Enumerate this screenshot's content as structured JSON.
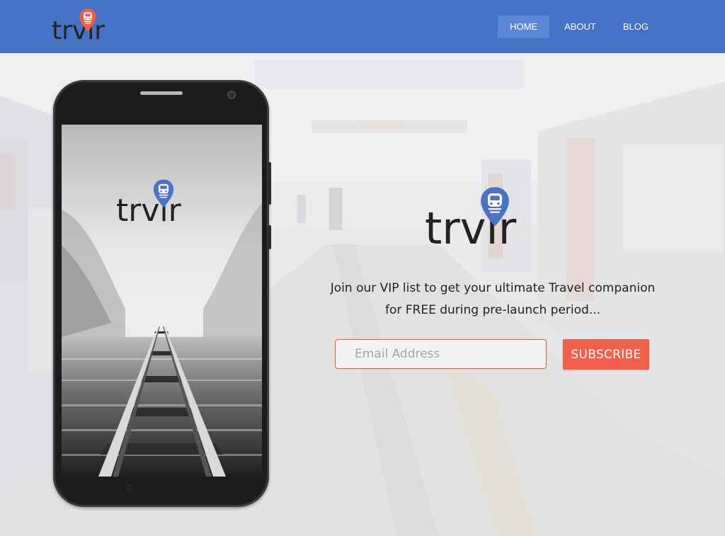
{
  "header": {
    "brand": "trvlr",
    "nav": [
      {
        "label": "HOME",
        "active": true
      },
      {
        "label": "ABOUT",
        "active": false
      },
      {
        "label": "BLOG",
        "active": false
      }
    ]
  },
  "phone": {
    "app_logo": "trvlr"
  },
  "hero": {
    "logo": "trvlr",
    "tagline_line1": "Join our VIP list to get your ultimate Travel companion",
    "tagline_line2": "for FREE during pre-launch period...",
    "email_placeholder": "Email Address",
    "subscribe_label": "SUBSCRIBE"
  },
  "colors": {
    "nav_bg": "#4572c4",
    "nav_active": "#5d87d6",
    "accent": "#f0604a",
    "pin_blue": "#4a73c7",
    "pin_red": "#ef5f45"
  },
  "icons": {
    "header_pin": "train-pin-icon",
    "phone_pin": "train-pin-icon",
    "hero_pin": "train-pin-icon"
  }
}
